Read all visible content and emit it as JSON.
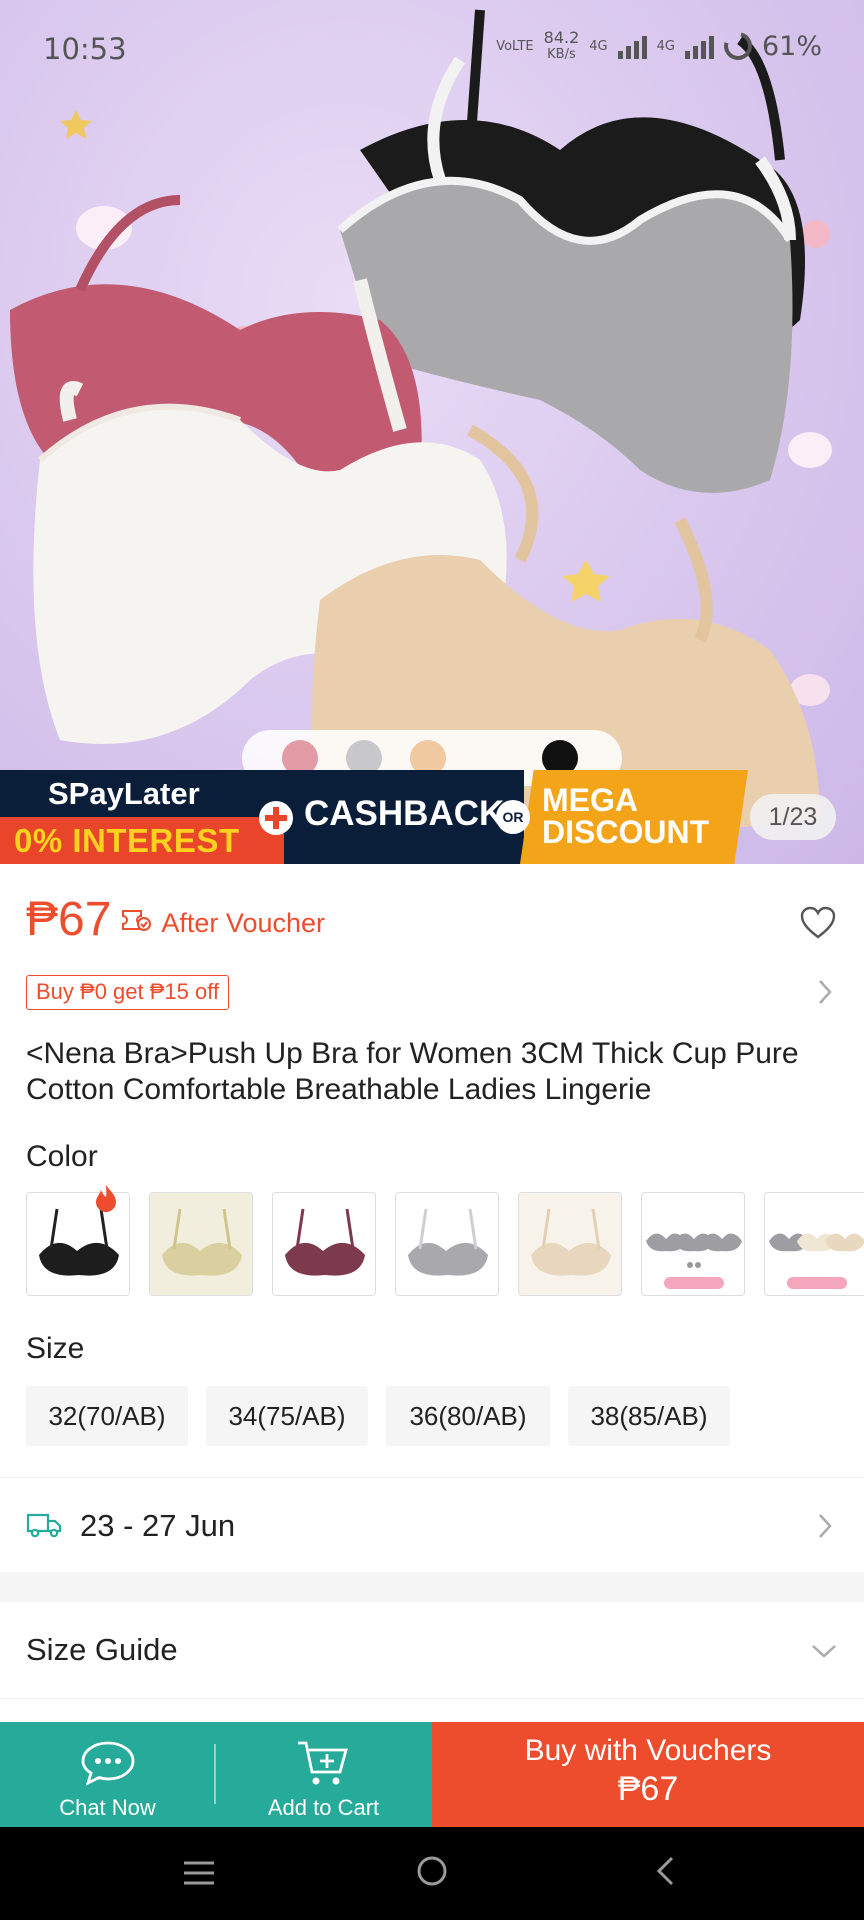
{
  "status_bar": {
    "time": "10:53",
    "net_type": "VoLTE",
    "net_speed": "84.2",
    "net_speed_unit": "KB/s",
    "signal_1": "4G",
    "signal_2": "4G",
    "battery": "61%"
  },
  "gallery": {
    "counter": "1/23",
    "promo": {
      "line1": "SPayLater",
      "line2": "0% INTEREST",
      "cashback": "CASHBACK",
      "or": "OR",
      "mega_line1": "MEGA",
      "mega_line2": "DISCOUNT"
    }
  },
  "product": {
    "price": "₱67",
    "price_note": "After Voucher",
    "voucher_tag": "Buy ₱0 get ₱15 off",
    "title": "<Nena Bra>Push Up Bra for Women 3CM Thick Cup Pure Cotton Comfortable Breathable Ladies Lingerie",
    "color_label": "Color",
    "colors": [
      "black",
      "beige",
      "wine",
      "grey",
      "nude",
      "set-3-grey",
      "set-3-mixed"
    ],
    "size_label": "Size",
    "sizes": [
      "32(70/AB)",
      "34(75/AB)",
      "36(80/AB)",
      "38(85/AB)"
    ]
  },
  "delivery": {
    "dates": "23 - 27 Jun"
  },
  "size_guide": {
    "label": "Size Guide"
  },
  "action_bar": {
    "chat_label": "Chat Now",
    "cart_label": "Add to Cart",
    "buy_label": "Buy with Vouchers",
    "buy_price": "₱67"
  },
  "theme": {
    "accent": "#ee4d2d",
    "teal": "#26aa99",
    "navy": "#0a1e3a",
    "orange": "#f4a418",
    "hero_bg": "#dccbef"
  }
}
